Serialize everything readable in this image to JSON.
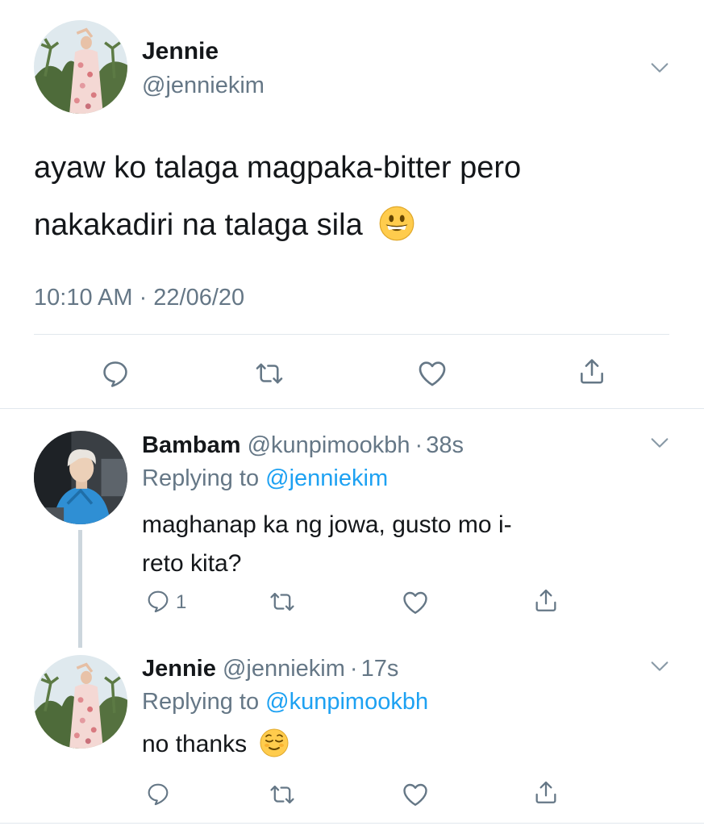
{
  "main_tweet": {
    "author_name": "Jennie",
    "author_handle": "@jenniekim",
    "text_line1": "ayaw ko talaga magpaka-bitter pero",
    "text_line2": "nakakadiri na talaga sila",
    "emoji": "grinning-face",
    "timestamp": "10:10 AM · 22/06/20"
  },
  "replies": [
    {
      "author_name": "Bambam",
      "author_handle": "@kunpimookbh",
      "separator": "·",
      "time": "38s",
      "replying_label": "Replying to",
      "replying_to": "@jenniekim",
      "text_line1": "maghanap ka ng jowa, gusto mo i-",
      "text_line2": "reto kita?",
      "reply_count": "1"
    },
    {
      "author_name": "Jennie",
      "author_handle": "@jenniekim",
      "separator": "·",
      "time": "17s",
      "replying_label": "Replying to",
      "replying_to": "@kunpimookbh",
      "text": "no thanks",
      "emoji": "relieved-face"
    }
  ],
  "icons": [
    "reply-icon",
    "retweet-icon",
    "like-icon",
    "share-icon",
    "chevron-down-icon"
  ],
  "colors": {
    "text": "#14171a",
    "secondary": "#657786",
    "link": "#1da1f2",
    "divider": "#e1e8ed"
  }
}
